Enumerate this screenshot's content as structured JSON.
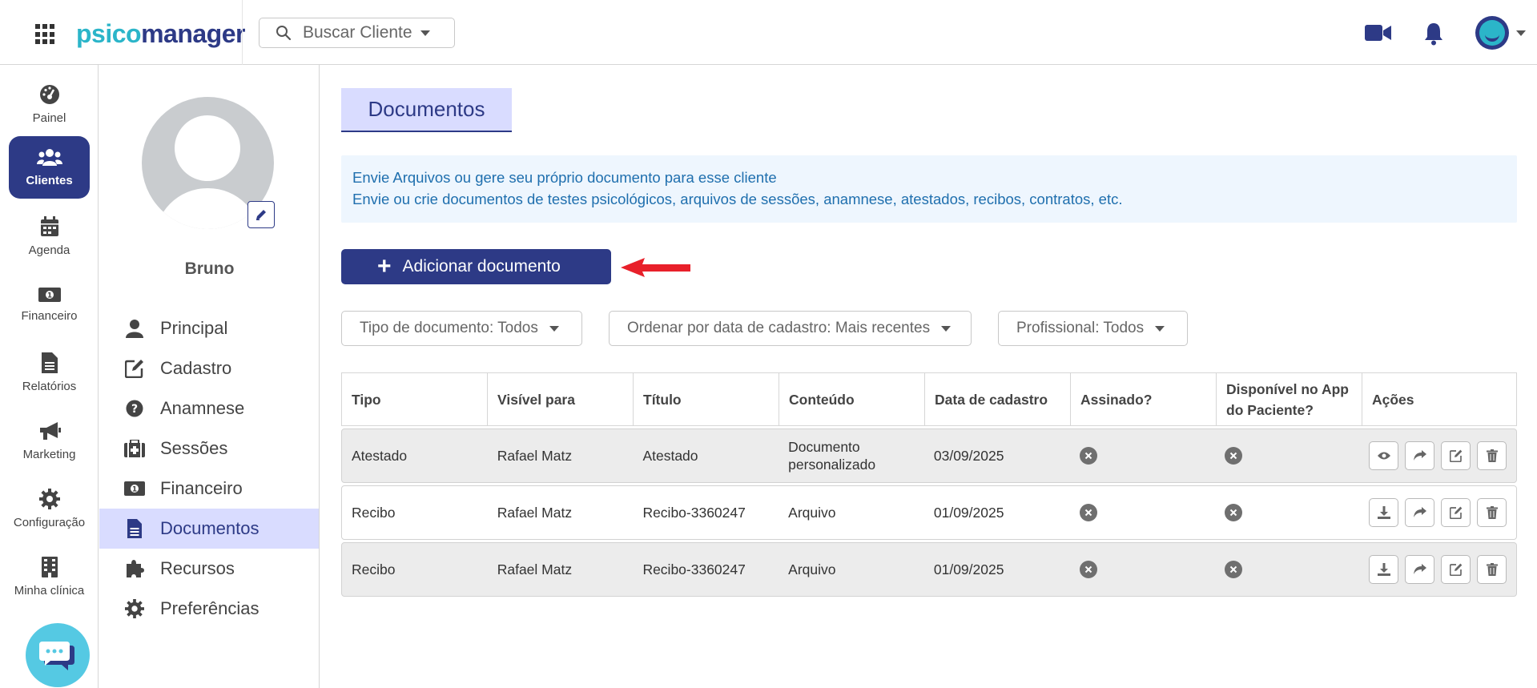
{
  "header": {
    "logo_part1": "psico",
    "logo_part2": "manager",
    "search_placeholder": "Buscar Cliente"
  },
  "nav": {
    "items": [
      {
        "label": "Painel",
        "icon": "dashboard-icon"
      },
      {
        "label": "Clientes",
        "icon": "users-icon",
        "active": true
      },
      {
        "label": "Agenda",
        "icon": "calendar-icon"
      },
      {
        "label": "Financeiro",
        "icon": "money-icon"
      },
      {
        "label": "Relatórios",
        "icon": "file-icon"
      },
      {
        "label": "Marketing",
        "icon": "megaphone-icon"
      },
      {
        "label": "Configuração",
        "icon": "gear-icon"
      },
      {
        "label": "Minha clínica",
        "icon": "building-icon"
      }
    ]
  },
  "client": {
    "name": "Bruno",
    "menu": [
      {
        "label": "Principal",
        "icon": "user-icon"
      },
      {
        "label": "Cadastro",
        "icon": "edit-icon"
      },
      {
        "label": "Anamnese",
        "icon": "question-icon"
      },
      {
        "label": "Sessões",
        "icon": "medkit-icon"
      },
      {
        "label": "Financeiro",
        "icon": "money-icon"
      },
      {
        "label": "Documentos",
        "icon": "document-icon",
        "active": true
      },
      {
        "label": "Recursos",
        "icon": "puzzle-icon"
      },
      {
        "label": "Preferências",
        "icon": "gear-icon"
      }
    ]
  },
  "main": {
    "title": "Documentos",
    "info_line1": "Envie Arquivos ou gere seu próprio documento para esse cliente",
    "info_line2": "Envie ou crie documentos de testes psicológicos, arquivos de sessões, anamnese, atestados, recibos, contratos, etc.",
    "add_button": "Adicionar documento",
    "filters": {
      "type": "Tipo de documento: Todos",
      "order": "Ordenar por data de cadastro: Mais recentes",
      "professional": "Profissional: Todos"
    },
    "table": {
      "headers": [
        "Tipo",
        "Visível para",
        "Título",
        "Conteúdo",
        "Data de cadastro",
        "Assinado?",
        "Disponível no App do Paciente?",
        "Ações"
      ],
      "rows": [
        {
          "tipo": "Atestado",
          "visivel": "Rafael Matz",
          "titulo": "Atestado",
          "conteudo": "Documento personalizado",
          "data": "03/09/2025"
        },
        {
          "tipo": "Recibo",
          "visivel": "Rafael Matz",
          "titulo": "Recibo-3360247",
          "conteudo": "Arquivo",
          "data": "01/09/2025"
        },
        {
          "tipo": "Recibo",
          "visivel": "Rafael Matz",
          "titulo": "Recibo-3360247",
          "conteudo": "Arquivo",
          "data": "01/09/2025"
        }
      ]
    }
  },
  "colors": {
    "primary": "#2d3a86",
    "accent": "#2bb5c9",
    "highlight": "#d9dcff",
    "info_bg": "#eef6fe",
    "info_text": "#1f6fae",
    "annotation_arrow": "#e8202a"
  }
}
